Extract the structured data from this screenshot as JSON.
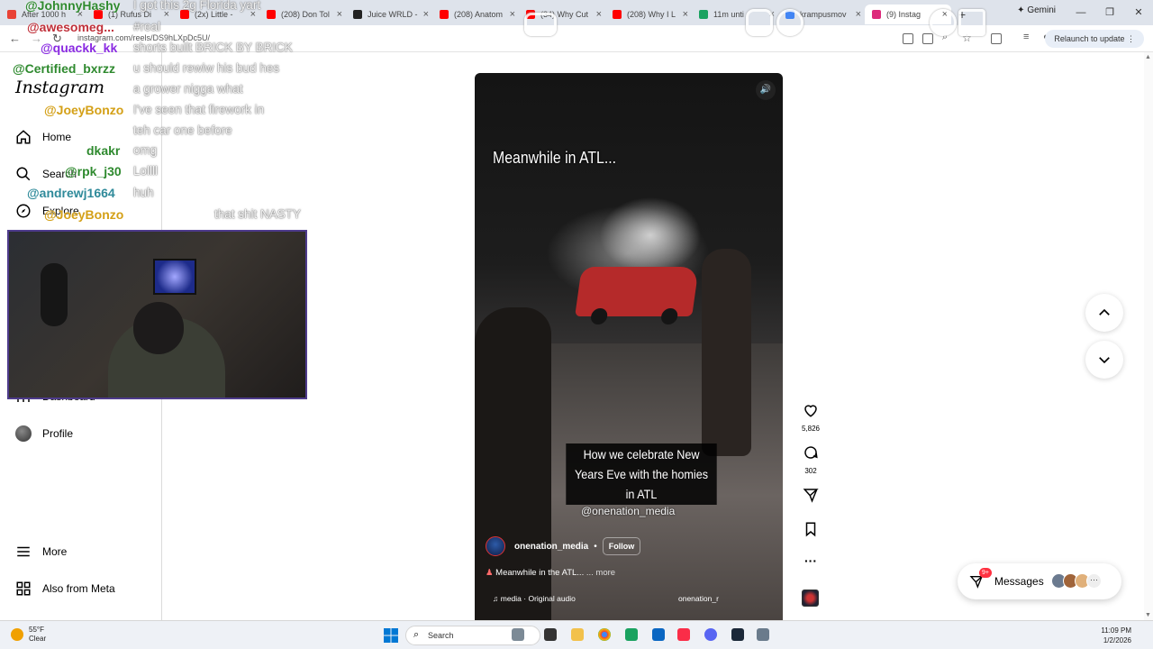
{
  "browser": {
    "tabs": [
      {
        "label": "After 1000 h",
        "color": "#e94235"
      },
      {
        "label": "(1) Rufus Di",
        "color": "#ff0000"
      },
      {
        "label": "(2x) Little -",
        "color": "#ff0000"
      },
      {
        "label": "(208) Don Tol",
        "color": "#ff0000"
      },
      {
        "label": "Juice WRLD -",
        "color": "#222222"
      },
      {
        "label": "(208) Anatom",
        "color": "#ff0000"
      },
      {
        "label": "(34) Why Cut",
        "color": "#ff0000"
      },
      {
        "label": "(208) Why I L",
        "color": "#ff0000"
      },
      {
        "label": "11m unti",
        "color": "#1aa260"
      },
      {
        "label": "krampusmov",
        "color": "#4285f4"
      },
      {
        "label": "(9) Instag",
        "color": "#dd2a7b"
      }
    ],
    "gemini_label": "Gemini",
    "url": "instagram.com/reels/DS9hLXpDc5U/",
    "relaunch_label": "Relaunch to update"
  },
  "sidebar": {
    "logo": "Instagram",
    "items": [
      {
        "label": "Home",
        "icon": "home-icon"
      },
      {
        "label": "Search",
        "icon": "search-icon"
      },
      {
        "label": "Explore",
        "icon": "compass-icon"
      },
      {
        "label": "Dashboard",
        "icon": "dashboard-icon"
      },
      {
        "label": "Profile",
        "icon": "avatar"
      },
      {
        "label": "More",
        "icon": "menu-icon"
      },
      {
        "label": "Also from Meta",
        "icon": "grid-icon"
      }
    ]
  },
  "reel": {
    "overlay_title": "Meanwhile in ATL...",
    "caption": "How we celebrate New Years Eve with the homies in ATL",
    "handle_overlay": "@onenation_media",
    "author": "onenation_media",
    "follow_label": "Follow",
    "description": "Meanwhile in the ATL...",
    "more_label": "... more",
    "audio": "media · Original audio",
    "audio_right": "onenation_r"
  },
  "actions": {
    "likes": "5,826",
    "comments": "302"
  },
  "messages": {
    "label": "Messages",
    "badge": "9+"
  },
  "chat": [
    {
      "user": "@JohnnyHashy",
      "msg": "I got this 2g Florida yart",
      "color": "#2f8a2f"
    },
    {
      "user": "@awesomeg...",
      "msg": "#real",
      "color": "#c0303a"
    },
    {
      "user": "@quackk_kk",
      "msg": "shorts built BRICK BY BRICK",
      "color": "#8a2be2"
    },
    {
      "user": "@Certified_bxrzz",
      "msg": "u should rewiw his bud hes",
      "color": "#2f8a2f"
    },
    {
      "user": "",
      "msg": "a grower nigga what",
      "color": "#2f8a2f"
    },
    {
      "user": "@JoeyBonzo",
      "msg": "I've seen that firework in",
      "color": "#d4a017"
    },
    {
      "user": "",
      "msg": "teh car one before",
      "color": "#d4a017"
    },
    {
      "user": "dkakr",
      "msg": "omg",
      "color": "#2f8a2f"
    },
    {
      "user": "@rpk_j30",
      "msg": "Lollll",
      "color": "#2f8a2f"
    },
    {
      "user": "@andrewj1664",
      "msg": "huh",
      "color": "#2f8a9a"
    },
    {
      "user": "@JoeyBonzo",
      "msg": "that shit NASTY",
      "color": "#d4a017"
    }
  ],
  "taskbar": {
    "weather_temp": "55°F",
    "weather_desc": "Clear",
    "search_label": "Search",
    "time": "11:09 PM",
    "date": "1/2/2026"
  }
}
